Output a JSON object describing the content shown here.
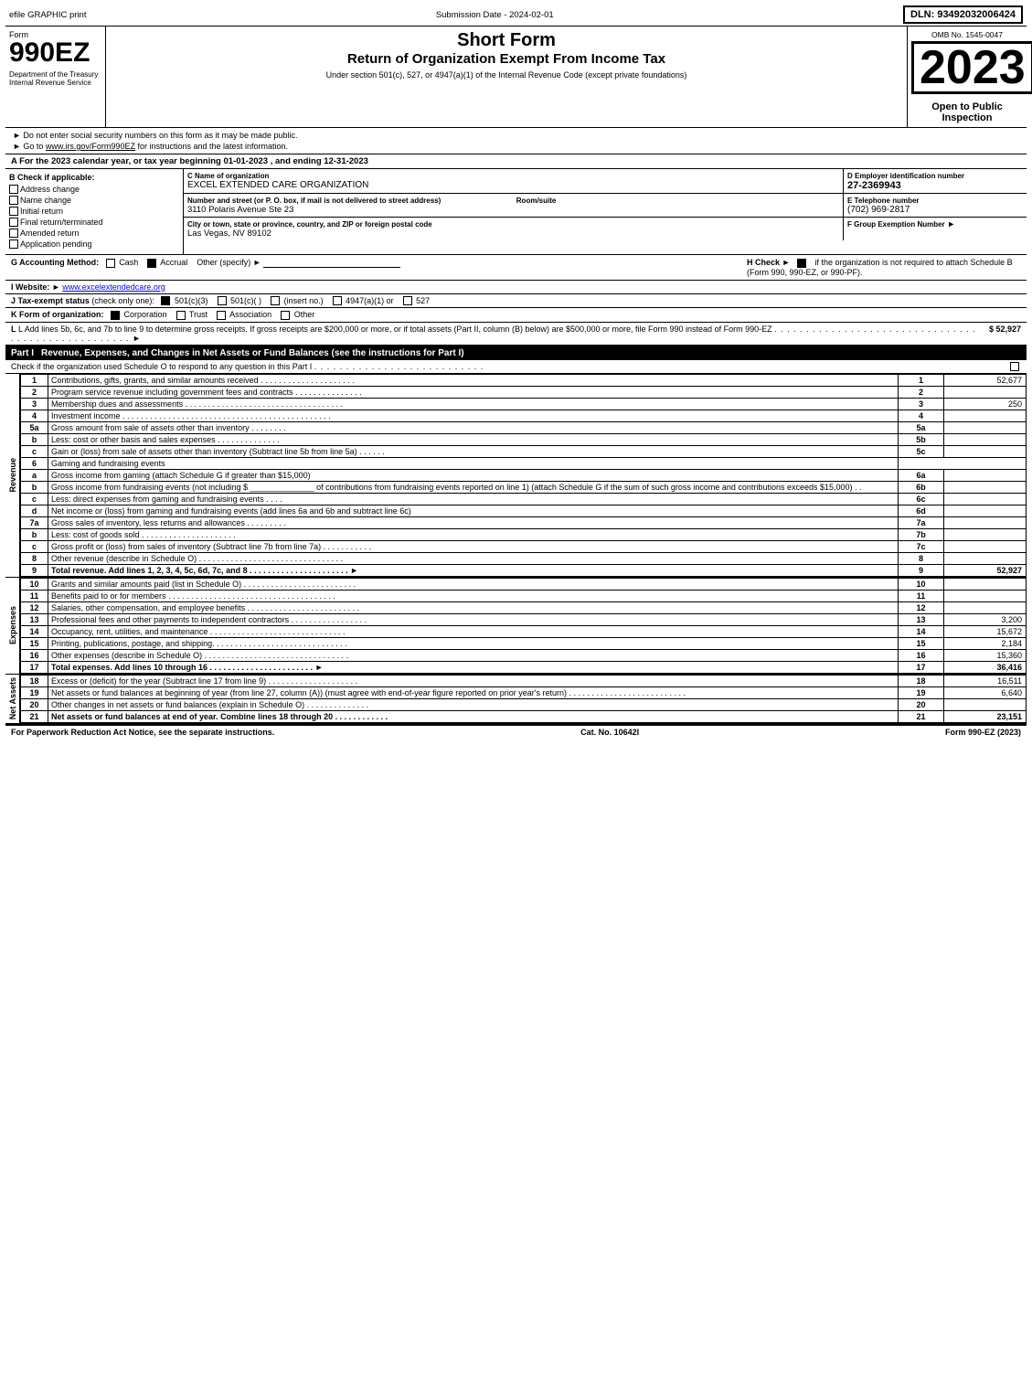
{
  "header": {
    "efile_label": "efile GRAPHIC print",
    "submission_date_label": "Submission Date - 2024-02-01",
    "dln_label": "DLN: 93492032006424",
    "omb_label": "OMB No. 1545-0047",
    "form_number": "990EZ",
    "form_label": "Form",
    "short_form": "Short Form",
    "return_title": "Return of Organization Exempt From Income Tax",
    "subtitle": "Under section 501(c), 527, or 4947(a)(1) of the Internal Revenue Code (except private foundations)",
    "year": "2023",
    "dept_label": "Department of the Treasury",
    "irs_label": "Internal Revenue Service",
    "open_to_public": "Open to Public Inspection"
  },
  "instructions": {
    "line1": "► Do not enter social security numbers on this form as it may be made public.",
    "line2": "► Go to www.irs.gov/Form990EZ for instructions and the latest information.",
    "irs_url": "www.irs.gov/Form990EZ"
  },
  "section_a": {
    "text": "A For the 2023 calendar year, or tax year beginning 01-01-2023 , and ending 12-31-2023"
  },
  "check_if_applicable": {
    "label": "B Check if applicable:",
    "items": [
      {
        "id": "address_change",
        "label": "Address change",
        "checked": false
      },
      {
        "id": "name_change",
        "label": "Name change",
        "checked": false
      },
      {
        "id": "initial_return",
        "label": "Initial return",
        "checked": false
      },
      {
        "id": "final_return",
        "label": "Final return/terminated",
        "checked": false
      },
      {
        "id": "amended_return",
        "label": "Amended return",
        "checked": false
      },
      {
        "id": "application_pending",
        "label": "Application pending",
        "checked": false
      }
    ]
  },
  "org": {
    "name_label": "C Name of organization",
    "name": "EXCEL EXTENDED CARE ORGANIZATION",
    "address_label": "Number and street (or P. O. box, if mail is not delivered to street address)",
    "address": "3110 Polaris Avenue Ste 23",
    "room_label": "Room/suite",
    "room": "",
    "city_label": "City or town, state or province, country, and ZIP or foreign postal code",
    "city": "Las Vegas, NV 89102",
    "ein_label": "D Employer identification number",
    "ein": "27-2369943",
    "phone_label": "E Telephone number",
    "phone": "(702) 969-2817",
    "group_ex_label": "F Group Exemption Number",
    "group_ex_arrow": "►"
  },
  "accounting": {
    "g_label": "G Accounting Method:",
    "cash_label": "Cash",
    "accrual_label": "Accrual",
    "accrual_checked": true,
    "other_label": "Other (specify) ►",
    "h_label": "H Check ►",
    "h_checked": true,
    "h_text": "if the organization is not required to attach Schedule B (Form 990, 990-EZ, or 990-PF)."
  },
  "website": {
    "label": "I Website: ►",
    "url": "www.excelextendedcare.org"
  },
  "tax_exempt": {
    "label": "J Tax-exempt status",
    "note": "(check only one):",
    "options": [
      {
        "id": "501c3",
        "label": "501(c)(3)",
        "checked": true
      },
      {
        "id": "501c",
        "label": "501(c)(  )",
        "checked": false
      },
      {
        "id": "insert",
        "label": "(insert no.)",
        "checked": false
      },
      {
        "id": "4947a1",
        "label": "4947(a)(1) or",
        "checked": false
      },
      {
        "id": "527",
        "label": "527",
        "checked": false
      }
    ]
  },
  "k_row": {
    "label": "K Form of organization:",
    "options": [
      {
        "id": "corporation",
        "label": "Corporation",
        "checked": true
      },
      {
        "id": "trust",
        "label": "Trust",
        "checked": false
      },
      {
        "id": "association",
        "label": "Association",
        "checked": false
      },
      {
        "id": "other",
        "label": "Other",
        "checked": false
      }
    ]
  },
  "l_row": {
    "text": "L Add lines 5b, 6c, and 7b to line 9 to determine gross receipts. If gross receipts are $200,000 or more, or if total assets (Part II, column (B) below) are $500,000 or more, file Form 990 instead of Form 990-EZ",
    "dots": ". . . . . . . . . . . . . . . . . . . . . . . . . . . . . . . . . . . . . . . . . . . . . . . . . . . ►",
    "amount": "$ 52,927"
  },
  "part1": {
    "label": "Part I",
    "title": "Revenue, Expenses, and Changes in Net Assets or Fund Balances",
    "note": "(see the instructions for Part I)",
    "check_line": "Check if the organization used Schedule O to respond to any question in this Part I",
    "dots": ". . . . . . . . . . . . . . . . . . . . . . . . . . .",
    "lines": [
      {
        "num": "1",
        "desc": "Contributions, gifts, grants, and similar amounts received . . . . . . . . . . . . . . . . . . . . .",
        "ref": "1",
        "amount": "52,677"
      },
      {
        "num": "2",
        "desc": "Program service revenue including government fees and contracts . . . . . . . . . . . . . . .",
        "ref": "2",
        "amount": ""
      },
      {
        "num": "3",
        "desc": "Membership dues and assessments . . . . . . . . . . . . . . . . . . . . . . . . . . . . . . . . . . .",
        "ref": "3",
        "amount": "250"
      },
      {
        "num": "4",
        "desc": "Investment income . . . . . . . . . . . . . . . . . . . . . . . . . . . . . . . . . . . . . . . . . . . . . .",
        "ref": "4",
        "amount": ""
      },
      {
        "num": "5a",
        "desc": "Gross amount from sale of assets other than inventory . . . . . . . .",
        "ref": "5a",
        "amount": "",
        "sub": true
      },
      {
        "num": "b",
        "desc": "Less: cost or other basis and sales expenses . . . . . . . . . . . . . .",
        "ref": "5b",
        "amount": "",
        "sub": true
      },
      {
        "num": "c",
        "desc": "Gain or (loss) from sale of assets other than inventory (Subtract line 5b from line 5a) . . . . . .",
        "ref": "5c",
        "amount": ""
      },
      {
        "num": "6",
        "desc": "Gaming and fundraising events",
        "ref": "",
        "amount": "",
        "header": true
      },
      {
        "num": "a",
        "desc": "Gross income from gaming (attach Schedule G if greater than $15,000)",
        "ref": "6a",
        "amount": "",
        "sub": true
      },
      {
        "num": "b",
        "desc": "Gross income from fundraising events (not including $ ______________ of contributions from fundraising events reported on line 1) (attach Schedule G if the sum of such gross income and contributions exceeds $15,000)  .  .",
        "ref": "6b",
        "amount": "",
        "sub": true
      },
      {
        "num": "c",
        "desc": "Less: direct expenses from gaming and fundraising events   .  .  .  .",
        "ref": "6c",
        "amount": "",
        "sub": true
      },
      {
        "num": "d",
        "desc": "Net income or (loss) from gaming and fundraising events (add lines 6a and 6b and subtract line 6c)",
        "ref": "6d",
        "amount": ""
      },
      {
        "num": "7a",
        "desc": "Gross sales of inventory, less returns and allowances . . . . . . . . .",
        "ref": "7a",
        "amount": "",
        "sub": true
      },
      {
        "num": "b",
        "desc": "Less: cost of goods sold   .  .  .  .  .  .  .  .  .  .  .  .  .  .  .  .  .  .  .  .  .",
        "ref": "7b",
        "amount": "",
        "sub": true
      },
      {
        "num": "c",
        "desc": "Gross profit or (loss) from sales of inventory (Subtract line 7b from line 7a)  . . . . . . . . . . .",
        "ref": "7c",
        "amount": ""
      },
      {
        "num": "8",
        "desc": "Other revenue (describe in Schedule O) . . . . . . . . . . . . . . . . . . . . . . . . . . . . . . . .",
        "ref": "8",
        "amount": ""
      },
      {
        "num": "9",
        "desc": "Total revenue. Add lines 1, 2, 3, 4, 5c, 6d, 7c, and 8 . . . . . . . . . . . . . . . . . . . . . . ►",
        "ref": "9",
        "amount": "52,927",
        "bold": true
      }
    ],
    "revenue_label": "Revenue"
  },
  "expenses": {
    "label": "Expenses",
    "lines": [
      {
        "num": "10",
        "desc": "Grants and similar amounts paid (list in Schedule O) . . . . . . . . . . . . . . . . . . . . . . . . .",
        "ref": "10",
        "amount": ""
      },
      {
        "num": "11",
        "desc": "Benefits paid to or for members  . . . . . . . . . . . . . . . . . . . . . . . . . . . . . . . . . . . . .",
        "ref": "11",
        "amount": ""
      },
      {
        "num": "12",
        "desc": "Salaries, other compensation, and employee benefits . . . . . . . . . . . . . . . . . . . . . . . . .",
        "ref": "12",
        "amount": ""
      },
      {
        "num": "13",
        "desc": "Professional fees and other payments to independent contractors . . . . . . . . . . . . . . . . .",
        "ref": "13",
        "amount": "3,200"
      },
      {
        "num": "14",
        "desc": "Occupancy, rent, utilities, and maintenance . . . . . . . . . . . . . . . . . . . . . . . . . . . . . .",
        "ref": "14",
        "amount": "15,672"
      },
      {
        "num": "15",
        "desc": "Printing, publications, postage, and shipping. . . . . . . . . . . . . . . . . . . . . . . . . . . . . .",
        "ref": "15",
        "amount": "2,184"
      },
      {
        "num": "16",
        "desc": "Other expenses (describe in Schedule O) . . . . . . . . . . . . . . . . . . . . . . . . . . . . . . . .",
        "ref": "16",
        "amount": "15,360"
      },
      {
        "num": "17",
        "desc": "Total expenses. Add lines 10 through 16   .  .  .  .  .  .  .  .  .  .  .  .  .  .  .  .  .  .  .  .  .  .  . ►",
        "ref": "17",
        "amount": "36,416",
        "bold": true
      }
    ]
  },
  "net_assets": {
    "label": "Net Assets",
    "lines": [
      {
        "num": "18",
        "desc": "Excess or (deficit) for the year (Subtract line 17 from line 9) . . . . . . . . . . . . . . . . . . . .",
        "ref": "18",
        "amount": "16,511"
      },
      {
        "num": "19",
        "desc": "Net assets or fund balances at beginning of year (from line 27, column (A)) (must agree with end-of-year figure reported on prior year's return) . . . . . . . . . . . . . . . . . . . . . . . . . .",
        "ref": "19",
        "amount": "6,640"
      },
      {
        "num": "20",
        "desc": "Other changes in net assets or fund balances (explain in Schedule O) . . . . . . . . . . . . . .",
        "ref": "20",
        "amount": ""
      },
      {
        "num": "21",
        "desc": "Net assets or fund balances at end of year. Combine lines 18 through 20 . . . . . . . . . . . .",
        "ref": "21",
        "amount": "23,151",
        "bold": true
      }
    ]
  },
  "footer": {
    "left": "For Paperwork Reduction Act Notice, see the separate instructions.",
    "cat": "Cat. No. 10642I",
    "right": "Form 990-EZ (2023)"
  }
}
